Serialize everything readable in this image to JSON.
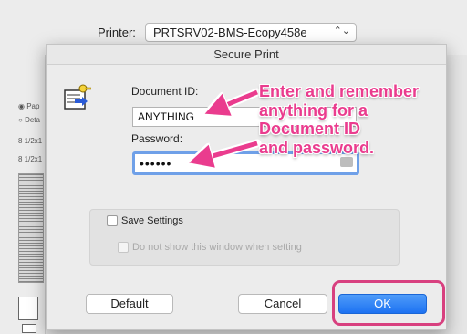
{
  "printer": {
    "label": "Printer:",
    "value": "PRTSRV02-BMS-Ecopy458e"
  },
  "background": {
    "radio_1": "Pap",
    "radio_2": "Deta",
    "size_1": "8 1/2x1",
    "size_2": "8 1/2x1"
  },
  "dialog": {
    "title": "Secure Print",
    "document_id_label": "Document ID:",
    "document_id_value": "ANYTHING",
    "password_label": "Password:",
    "password_value": "••••••",
    "save_settings_label": "Save Settings",
    "no_show_label": "Do not show this window when setting",
    "default_button": "Default",
    "cancel_button": "Cancel",
    "ok_button": "OK"
  },
  "annotation": {
    "lines": [
      "Enter and remember",
      "anything for a",
      "Document ID",
      "and password."
    ]
  },
  "colors": {
    "annotation": "#ea3c8e",
    "ok_button": "#1d72f2",
    "focus_ring": "#6fa0e8"
  }
}
